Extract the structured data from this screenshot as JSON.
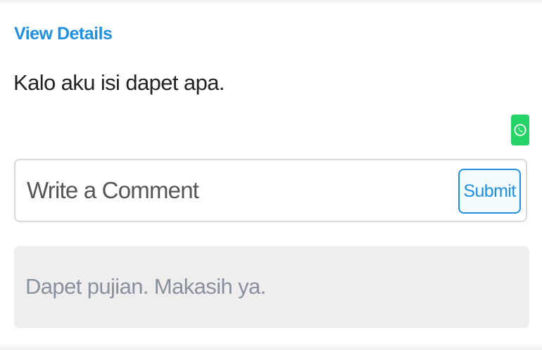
{
  "post": {
    "view_details_label": "View Details",
    "question_text": "Kalo aku isi dapet apa."
  },
  "share": {
    "whatsapp_icon": "whatsapp-icon",
    "whatsapp_color": "#25d366"
  },
  "comment": {
    "placeholder": "Write a Comment",
    "value": "",
    "submit_label": "Submit"
  },
  "answer": {
    "text": "Dapet pujian. Makasih ya."
  },
  "colors": {
    "accent": "#1e8fe1",
    "answer_background": "#eeeeee",
    "answer_text": "#8a8f9c"
  }
}
